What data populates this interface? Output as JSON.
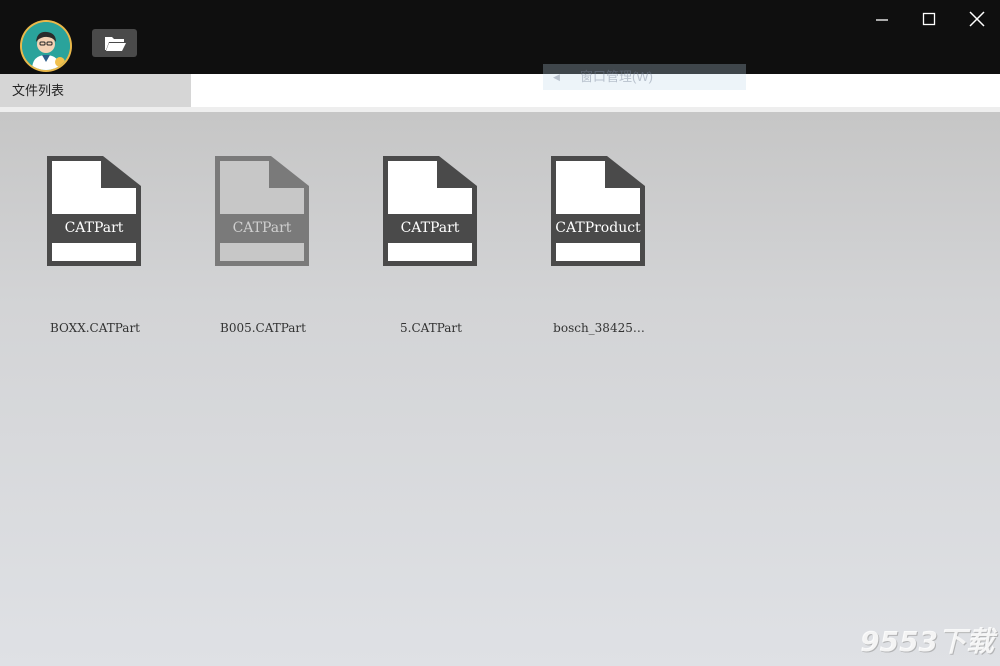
{
  "titlebar": {
    "avatar_icon": "avatar-icon",
    "open_folder_icon": "folder-open-icon",
    "window_controls": [
      "minimize-icon",
      "maximize-icon",
      "close-icon"
    ]
  },
  "tabs": {
    "file_list_label": "文件列表",
    "faded_menu_label": "窗口管理(W)"
  },
  "files": [
    {
      "badge": "CATPart",
      "name": "BOXX.CATPart",
      "selected": false
    },
    {
      "badge": "CATPart",
      "name": "B005.CATPart",
      "selected": true
    },
    {
      "badge": "CATPart",
      "name": "5.CATPart",
      "selected": false
    },
    {
      "badge": "CATProduct",
      "name": "bosch_38425…",
      "selected": false
    }
  ],
  "watermark": "9553下载",
  "colors": {
    "titlebar": "#0f0f0f",
    "file_icon": "#4a4a4a",
    "file_icon_selected": "#7a7a7a"
  }
}
